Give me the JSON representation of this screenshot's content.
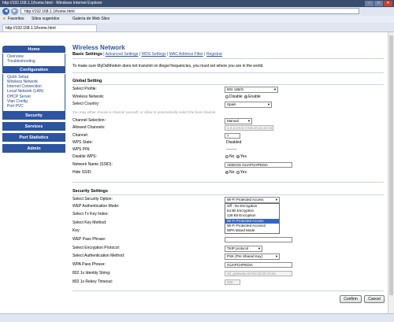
{
  "window": {
    "title": "http://192.168.1.1/home.html - Windows Internet Explorer"
  },
  "browser": {
    "address": "http://192.168.1.1/home.html",
    "favorites_label": "Favoritos",
    "fav_items": [
      "Sitios sugeridos",
      "Galería de Web Slice"
    ],
    "tab_label": "http://192.168.1.1/home.html"
  },
  "sidebar": {
    "home": "Home",
    "home_items": [
      "Overview",
      "Troubleshooting"
    ],
    "configuration": "Configuration",
    "config_items": [
      "Quick Setup",
      "Wireless Network",
      "Internet Connection",
      "Local Network (LAN)",
      "DHCP Server",
      "Vlan Config",
      "Port PVC"
    ],
    "security": "Security",
    "services": "Services",
    "port_statistics": "Port Statistics",
    "admin": "Admin"
  },
  "main": {
    "title": "Wireless Network",
    "tabs": {
      "basic": "Basic Settings",
      "advanced": "Advanced Settings",
      "wds": "WDS Settings",
      "mac": "MAC Address Filter",
      "reg": "Registrar"
    },
    "notice": "To make sure MyDslModem does not transmit on illegal frequencies, you must set where you are in the world.",
    "global_heading": "Global Setting",
    "select_profile_label": "Select Profile:",
    "select_profile_value": "802.11B/G",
    "wireless_network_label": "Wireless Network:",
    "disable_label": "Disable",
    "enable_label": "Enable",
    "select_country_label": "Select Country:",
    "select_country_value": "Spain",
    "country_note": "You may either choose a channel yourself, or allow to automatically select the best channel.",
    "channel_selection_label": "Channel Selection:",
    "channel_selection_value": "Manual",
    "allowed_channels_label": "Allowed Channels:",
    "allowed_channels_value": "1,2,3,4,5,6,7,8,9,10,11,12,13",
    "channel_label": "Channel:",
    "channel_value": "7",
    "wps_state_label": "WPS State:",
    "wps_state_value": "Disabled",
    "wps_pin_label": "WPS PIN:",
    "wps_pin_value": "--------",
    "disable_wps_label": "Disable WPS:",
    "no_label": "No",
    "yes_label": "Yes",
    "ssid_label": "Network Name (SSID):",
    "ssid_value": "AMIGOS GUAPCHPEDIA",
    "hide_ssid_label": "Hide SSID:",
    "security_heading": "Security Settings",
    "select_security_label": "Select Security Option:",
    "select_security_value": "Wi-Fi Protected Access",
    "wep_auth_label": "WEP Authentication Mode:",
    "select_tx_key_label": "Select Tx Key Index:",
    "select_key_method_label": "Select Key Method:",
    "key_label": "Key:",
    "wep_pass_label": "WEP Pass Phrase:",
    "encryption_protocol_label": "Select Encryption Protocol:",
    "encryption_protocol_value": "TKIP protocol",
    "auth_method_label": "Select Authentication Method:",
    "auth_method_value": "PSK (Pre Shared Key)",
    "wpa_pass_label": "WPA Pass Phrase:",
    "wpa_pass_value": "GUAPCHPEDIA",
    "identity_label": "802.1x Identity String:",
    "identity_value": "00_gateway-e0:91:53:29:10:a1",
    "rekey_label": "802.1x Rekey Timeout:",
    "rekey_value": "900",
    "dropdown_options": [
      "Off - No Encryption",
      "64 Bit Encryption",
      "128 Bit Encryption",
      "Wi-Fi Protected Access",
      "Wi-Fi Protected Access2",
      "WPA Mixed Mode"
    ],
    "dropdown_selected_index": 3,
    "confirm_label": "Confirm",
    "cancel_label": "Cancel"
  }
}
